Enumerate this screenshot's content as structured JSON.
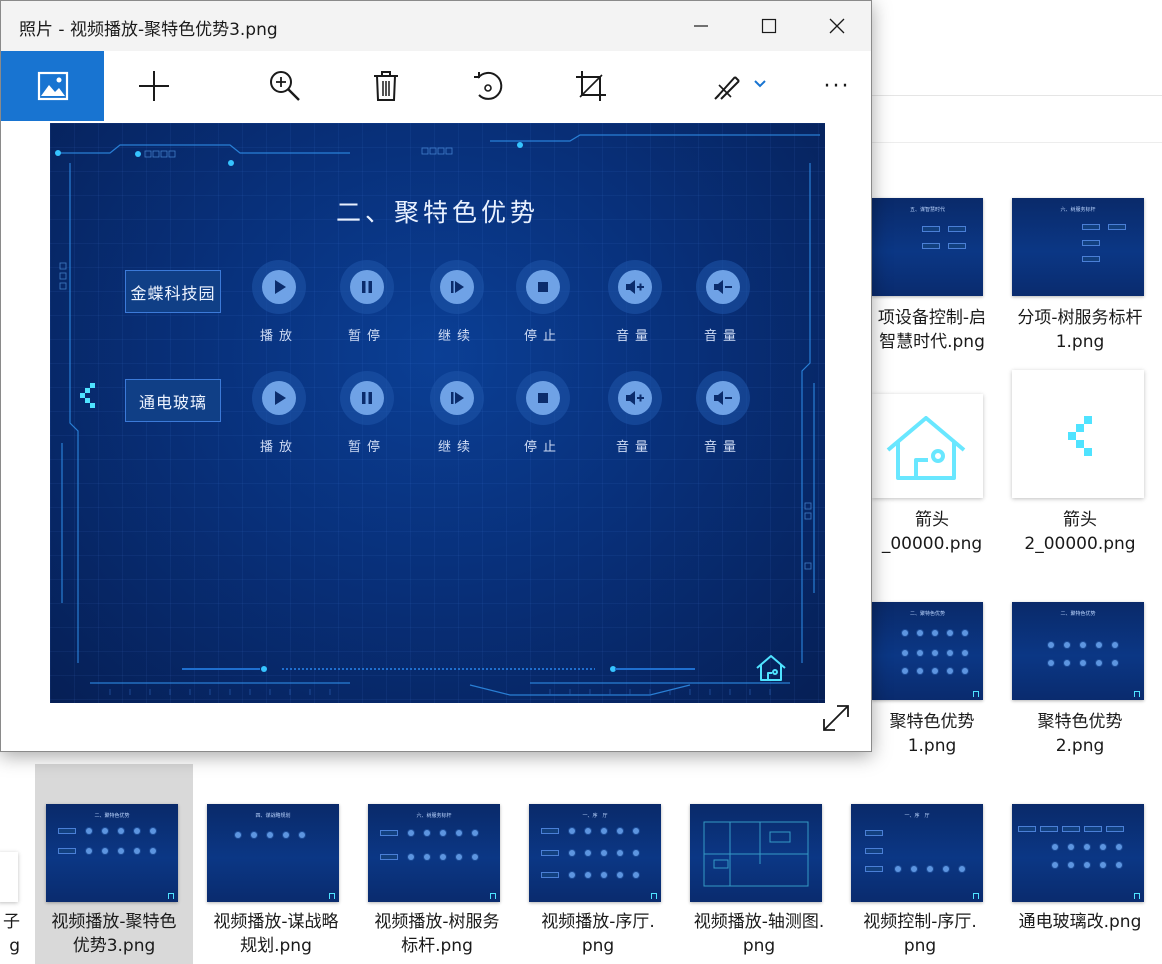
{
  "window": {
    "title": "照片 - 视频播放-聚特色优势3.png"
  },
  "window_controls": {
    "minimize": "—",
    "maximize": "☐",
    "close": "✕"
  },
  "toolbar": {
    "tools": [
      "view-photo-icon",
      "add-icon",
      "zoom-icon",
      "delete-icon",
      "rotate-icon",
      "crop-icon",
      "edit-draw-icon",
      "more-icon"
    ],
    "more": "···"
  },
  "slide": {
    "title": "二、聚特色优势",
    "rows": [
      {
        "label": "金蝶科技园"
      },
      {
        "label": "通电玻璃"
      }
    ],
    "controls": [
      "播放",
      "暂停",
      "继续",
      "停止",
      "音量",
      "音量"
    ],
    "control_icons": [
      "play-icon",
      "pause-icon",
      "resume-icon",
      "stop-icon",
      "volume-up-icon",
      "volume-down-icon"
    ]
  },
  "files": [
    {
      "name_lines": [
        "项设备控制-启",
        "智慧时代.png"
      ]
    },
    {
      "name_lines": [
        "分项-树服务标杆",
        "1.png"
      ]
    },
    {
      "name_lines": [
        "箭头",
        "_00000.png"
      ]
    },
    {
      "name_lines": [
        "箭头",
        "2_00000.png"
      ]
    },
    {
      "name_lines": [
        "聚特色优势",
        "1.png"
      ]
    },
    {
      "name_lines": [
        "聚特色优势",
        "2.png"
      ]
    },
    {
      "name_lines": [
        "子",
        "g"
      ]
    },
    {
      "name_lines": [
        "视频播放-聚特色",
        "优势3.png"
      ]
    },
    {
      "name_lines": [
        "视频播放-谋战略",
        "规划.png"
      ]
    },
    {
      "name_lines": [
        "视频播放-树服务",
        "标杆.png"
      ]
    },
    {
      "name_lines": [
        "视频播放-序厅.",
        "png"
      ]
    },
    {
      "name_lines": [
        "视频播放-轴测图.",
        "png"
      ]
    },
    {
      "name_lines": [
        "视频控制-序厅.",
        "png"
      ]
    },
    {
      "name_lines": [
        "通电玻璃改.png"
      ]
    }
  ],
  "thumb_titles": {
    "t1": "五、谋智慧时代",
    "t2": "六、树服务标杆",
    "t5": "二、聚特色优势",
    "t6": "二、聚特色优势",
    "t8": "二、聚特色优势",
    "t9": "四、谋战略规划",
    "t10": "六、树服务标杆",
    "t11": "一、序　厅",
    "t13": "一、序　厅"
  },
  "colors": {
    "accent": "#1874d1",
    "slide_bg": "#08307a",
    "glow": "#4fe3ff"
  }
}
